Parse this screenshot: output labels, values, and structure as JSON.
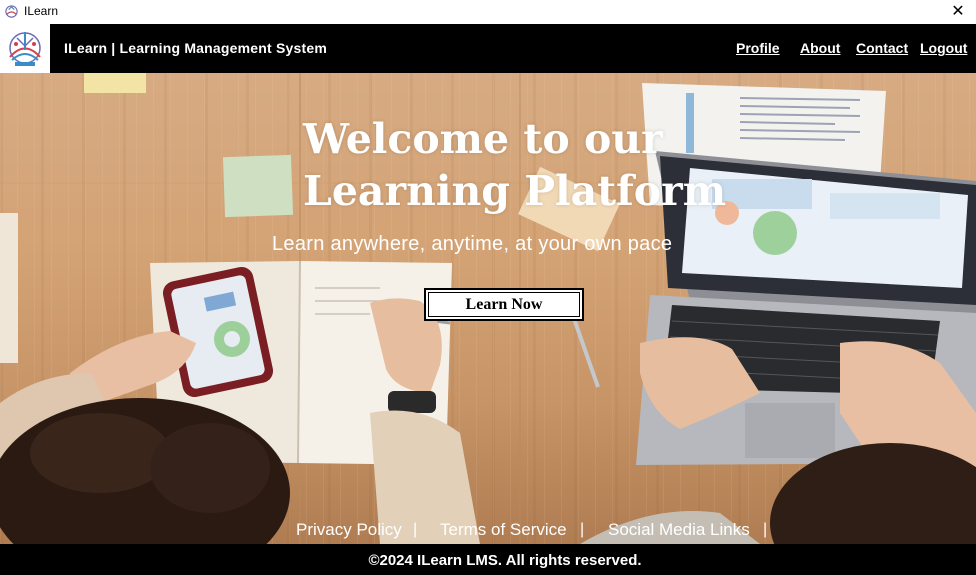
{
  "window": {
    "title": "ILearn",
    "close_glyph": "✕"
  },
  "header": {
    "brand": "ILearn | Learning Management System",
    "nav": [
      {
        "label": "Profile"
      },
      {
        "label": "About"
      },
      {
        "label": "Contact"
      },
      {
        "label": "Logout"
      }
    ]
  },
  "hero": {
    "title_line1": "Welcome to our",
    "title_line2": "Learning Platform",
    "subtitle": "Learn anywhere, anytime, at your own pace",
    "cta_label": "Learn Now"
  },
  "footer": {
    "links": [
      {
        "label": "Privacy Policy"
      },
      {
        "label": "Terms of Service"
      },
      {
        "label": "Social Media Links"
      }
    ],
    "separator": "|",
    "copyright": "©2024 ILearn LMS. All rights reserved."
  },
  "colors": {
    "header_bg": "#000000",
    "footer_bg": "#000000",
    "text_light": "#ffffff",
    "desk": "#d3a274"
  }
}
